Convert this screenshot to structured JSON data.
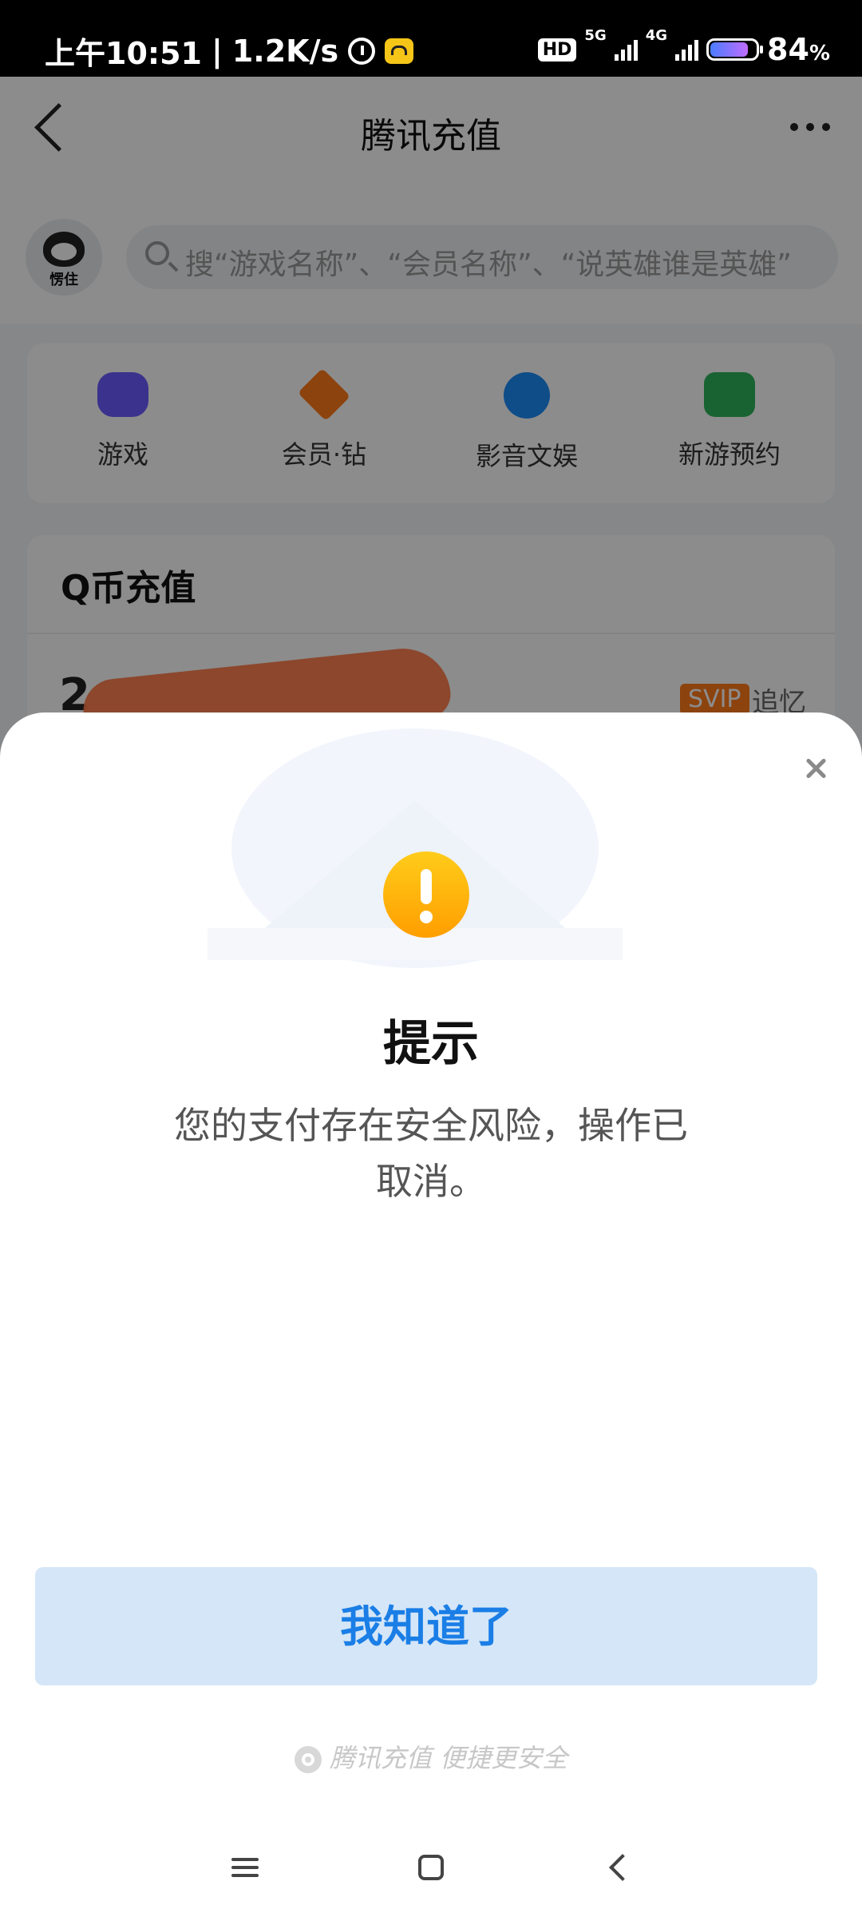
{
  "status_bar": {
    "time": "上午10:51",
    "speed": "1.2K/s",
    "hd": "HD",
    "net1": "5G",
    "net2": "4G",
    "battery_pct": "84",
    "battery_unit": "%"
  },
  "header": {
    "title": "腾讯充值"
  },
  "search": {
    "avatar_text": "愣住",
    "placeholder": "搜“游戏名称”、“会员名称”、“说英雄谁是英雄”"
  },
  "categories": [
    {
      "label": "游戏",
      "icon": "gamepad-icon"
    },
    {
      "label": "会员·钻",
      "icon": "diamond-icon"
    },
    {
      "label": "影音文娱",
      "icon": "play-icon"
    },
    {
      "label": "新游预约",
      "icon": "calendar-icon"
    }
  ],
  "qcoin": {
    "title": "Q币充值",
    "account_prefix": "2",
    "badge": "SVIP",
    "nickname": "追忆"
  },
  "dialog": {
    "title": "提示",
    "message": "您的支付存在安全风险，操作已取消。",
    "ok_label": "我知道了",
    "footer": "腾讯充值 便捷更安全"
  },
  "colors": {
    "accent": "#1a7ee6",
    "button_bg": "#d4e6f7",
    "warning": "#ffb400"
  }
}
